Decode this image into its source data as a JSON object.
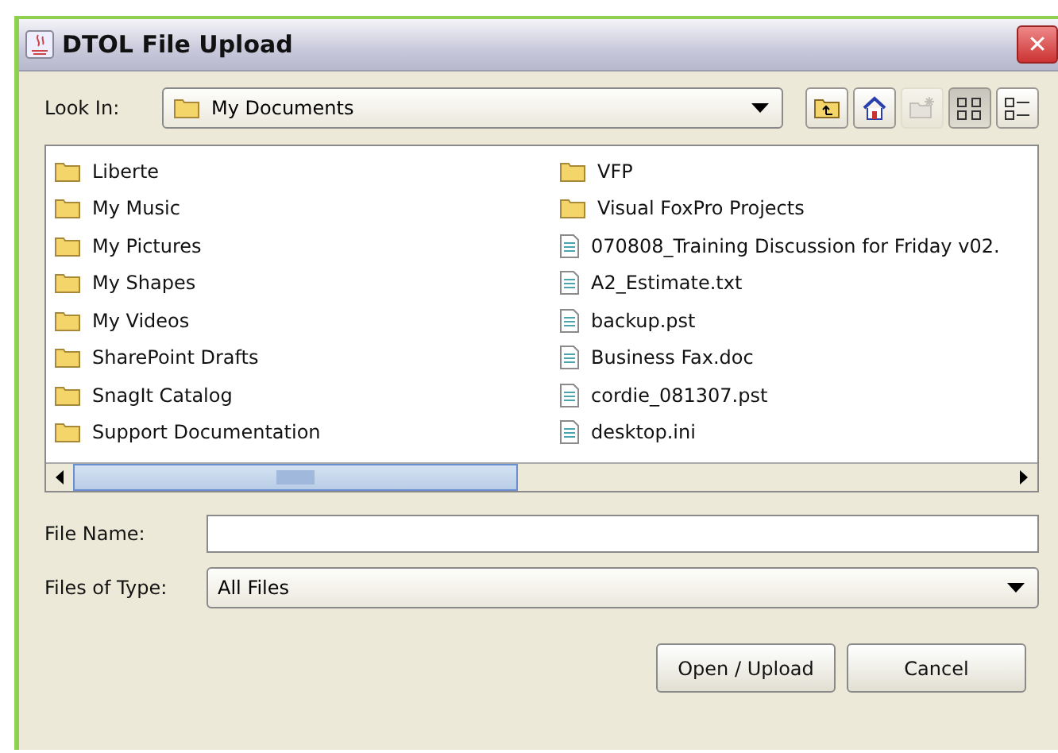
{
  "window": {
    "title": "DTOL File Upload",
    "close": "✕"
  },
  "look_in": {
    "label": "Look In:",
    "value": "My Documents"
  },
  "toolbar": [
    {
      "kind": "up",
      "disabled": false,
      "selected": false
    },
    {
      "kind": "home",
      "disabled": false,
      "selected": false
    },
    {
      "kind": "newfolder",
      "disabled": true,
      "selected": false
    },
    {
      "kind": "list",
      "disabled": false,
      "selected": true
    },
    {
      "kind": "details",
      "disabled": false,
      "selected": false
    }
  ],
  "files": [
    {
      "name": "Liberte",
      "kind": "folder"
    },
    {
      "name": "My Music",
      "kind": "folder"
    },
    {
      "name": "My Pictures",
      "kind": "folder"
    },
    {
      "name": "My Shapes",
      "kind": "folder"
    },
    {
      "name": "My Videos",
      "kind": "folder"
    },
    {
      "name": "SharePoint Drafts",
      "kind": "folder"
    },
    {
      "name": "SnagIt Catalog",
      "kind": "folder"
    },
    {
      "name": "Support Documentation",
      "kind": "folder"
    },
    {
      "name": "VFP",
      "kind": "folder"
    },
    {
      "name": "Visual FoxPro Projects",
      "kind": "folder"
    },
    {
      "name": "070808_Training Discussion for Friday v02.",
      "kind": "file"
    },
    {
      "name": "A2_Estimate.txt",
      "kind": "file"
    },
    {
      "name": "backup.pst",
      "kind": "file"
    },
    {
      "name": "Business Fax.doc",
      "kind": "file"
    },
    {
      "name": "cordie_081307.pst",
      "kind": "file"
    },
    {
      "name": "desktop.ini",
      "kind": "file"
    }
  ],
  "file_name": {
    "label": "File Name:"
  },
  "file_type": {
    "label": "Files of Type:",
    "value": "All Files"
  },
  "buttons": [
    "Open / Upload",
    "Cancel"
  ]
}
